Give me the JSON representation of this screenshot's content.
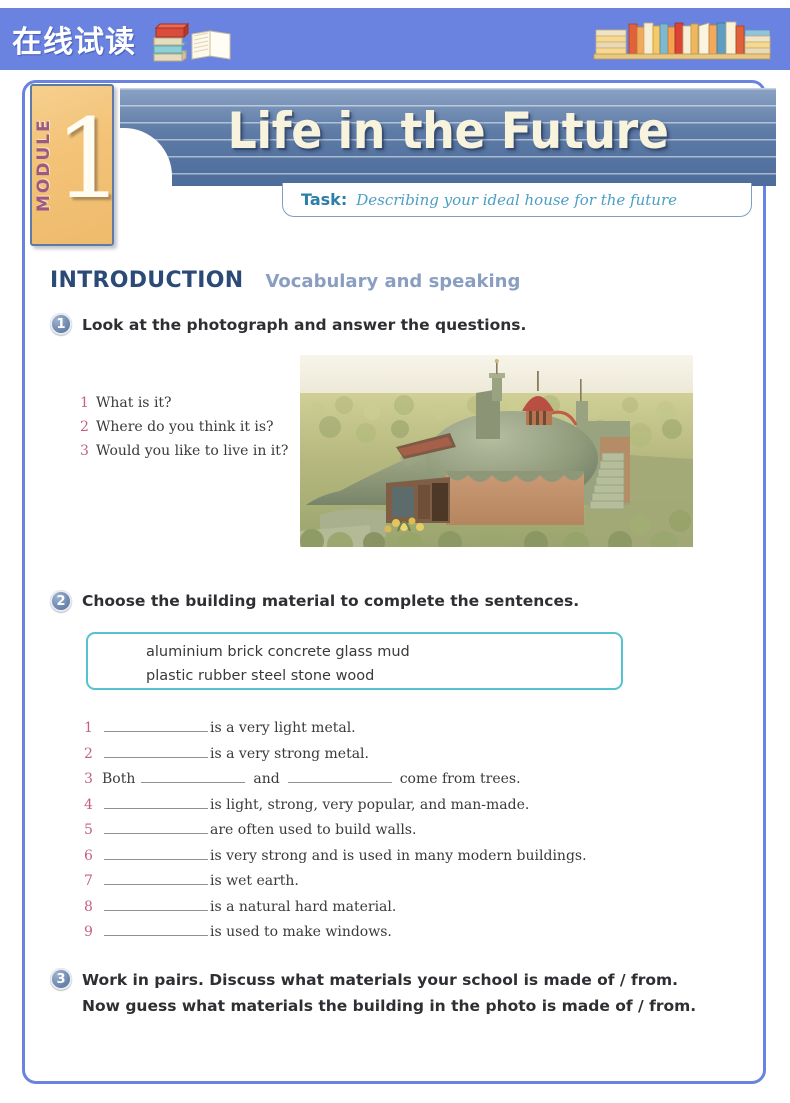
{
  "watermark": {
    "text": "在线试读",
    "logo_icon": "stacked-books-icon",
    "shelf_icon": "bookshelf-icon",
    "banner_color": "#6b83e0"
  },
  "module": {
    "tab_word": "MODULE",
    "tab_number": "1",
    "title": "Life in the Future",
    "tab_color": "#f3c378",
    "tab_word_color": "#9a5a82",
    "banner_color": "#5d7ba6",
    "title_color": "#f7f3dc"
  },
  "task": {
    "label": "Task:",
    "text": "Describing your ideal house for the future",
    "label_color": "#2b7fa8",
    "text_color": "#4a9fc4"
  },
  "section": {
    "heading": "INTRODUCTION",
    "subheading": "Vocabulary and speaking",
    "heading_color": "#2c4a78",
    "subheading_color": "#8a9ec2"
  },
  "exercises": [
    {
      "number": "1",
      "instruction": "Look at the photograph and answer the questions."
    },
    {
      "number": "2",
      "instruction": "Choose the building material to complete the sentences."
    },
    {
      "number": "3",
      "instruction": "Work in pairs. Discuss what materials your school is made of / from.",
      "instruction_line2": "Now guess what materials the building in the photo is made of / from."
    }
  ],
  "questions": [
    {
      "num": "1",
      "text": "What is it?"
    },
    {
      "num": "2",
      "text": "Where do you think it is?"
    },
    {
      "num": "3",
      "text": "Would you like to live in it?"
    }
  ],
  "photo": {
    "alt": "earthship-house-photo",
    "description": "A dome-roofed earth-sheltered house with terracotta walls set in desert scrubland"
  },
  "word_bank": {
    "border_color": "#55c2cf",
    "row1": [
      "aluminium",
      "brick",
      "concrete",
      "glass",
      "mud"
    ],
    "row2": [
      "plastic",
      "rubber",
      "steel",
      "stone",
      "wood"
    ],
    "row1_text": "aluminium        brick        concrete        glass        mud",
    "row2_text": "plastic        rubber        steel        stone        wood"
  },
  "sentences": [
    {
      "num": "1",
      "pre": "",
      "mid": "",
      "post": "is a very light metal.",
      "blanks": 1
    },
    {
      "num": "2",
      "pre": "",
      "mid": "",
      "post": "is a very strong metal.",
      "blanks": 1
    },
    {
      "num": "3",
      "pre": "Both",
      "mid": "and",
      "post": "come from trees.",
      "blanks": 2
    },
    {
      "num": "4",
      "pre": "",
      "mid": "",
      "post": "is light, strong, very popular, and man-made.",
      "blanks": 1
    },
    {
      "num": "5",
      "pre": "",
      "mid": "",
      "post": "are often used to build walls.",
      "blanks": 1
    },
    {
      "num": "6",
      "pre": "",
      "mid": "",
      "post": "is very strong and is used in many modern buildings.",
      "blanks": 1
    },
    {
      "num": "7",
      "pre": "",
      "mid": "",
      "post": "is wet earth.",
      "blanks": 1
    },
    {
      "num": "8",
      "pre": "",
      "mid": "",
      "post": "is a natural hard material.",
      "blanks": 1
    },
    {
      "num": "9",
      "pre": "",
      "mid": "",
      "post": "is used to make windows.",
      "blanks": 1
    }
  ],
  "frame": {
    "border_color": "#6b83e0"
  }
}
